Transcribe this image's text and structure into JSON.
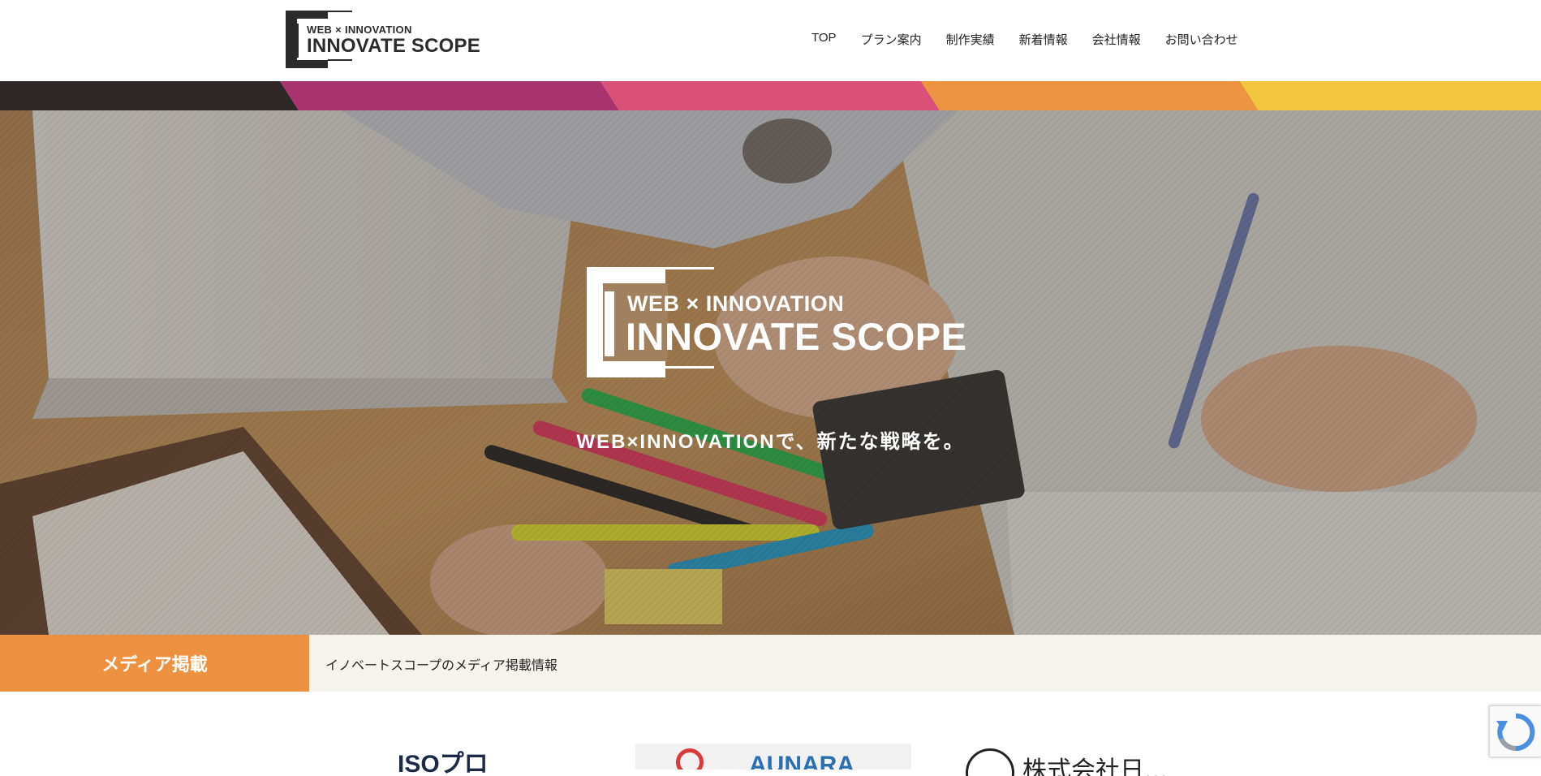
{
  "header": {
    "logo": {
      "line1": "WEB × INNOVATION",
      "line2": "INNOVATE SCOPE"
    },
    "nav": [
      {
        "label": "TOP",
        "name": "nav-top"
      },
      {
        "label": "プラン案内",
        "name": "nav-plans"
      },
      {
        "label": "制作実績",
        "name": "nav-works"
      },
      {
        "label": "新着情報",
        "name": "nav-news"
      },
      {
        "label": "会社情報",
        "name": "nav-company"
      },
      {
        "label": "お問い合わせ",
        "name": "nav-contact"
      }
    ]
  },
  "stripe_colors": [
    "#2e2726",
    "#a8336e",
    "#db5079",
    "#ec9440",
    "#f2c63f"
  ],
  "hero": {
    "logo": {
      "line1": "WEB × INNOVATION",
      "line2": "INNOVATE SCOPE"
    },
    "tagline": "WEB×INNOVATIONで、新たな戦略を。"
  },
  "media": {
    "label": "メディア掲載",
    "description": "イノベートスコープのメディア掲載情報"
  },
  "media_logos": [
    {
      "text": "ISOプロ"
    },
    {
      "text": "AUNARA"
    },
    {
      "text": "株式会社日..."
    }
  ],
  "colors": {
    "accent_orange": "#ed9140",
    "text_dark": "#2b2b2b",
    "media_bg": "#f6f3ec"
  }
}
